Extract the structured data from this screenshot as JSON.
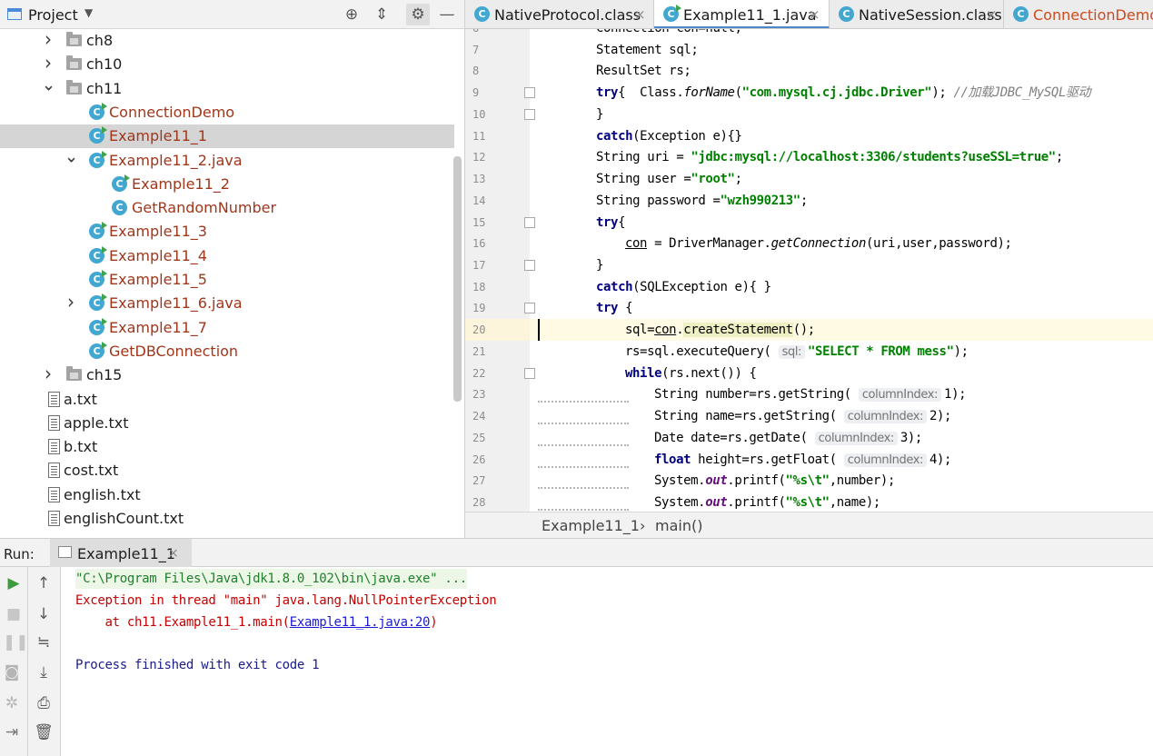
{
  "project_panel": {
    "title": "Project",
    "tree": [
      {
        "label": "ch8",
        "type": "folder",
        "indent": 0,
        "arrow": "collapsed"
      },
      {
        "label": "ch10",
        "type": "folder",
        "indent": 0,
        "arrow": "collapsed"
      },
      {
        "label": "ch11",
        "type": "folder",
        "indent": 0,
        "arrow": "expanded"
      },
      {
        "label": "ConnectionDemo",
        "type": "class",
        "indent": 1,
        "arrow": "none"
      },
      {
        "label": "Example11_1",
        "type": "class",
        "indent": 1,
        "arrow": "none",
        "selected": true
      },
      {
        "label": "Example11_2.java",
        "type": "class",
        "indent": 1,
        "arrow": "expanded"
      },
      {
        "label": "Example11_2",
        "type": "class",
        "indent": 2,
        "arrow": "none"
      },
      {
        "label": "GetRandomNumber",
        "type": "class-plain",
        "indent": 2,
        "arrow": "none"
      },
      {
        "label": "Example11_3",
        "type": "class",
        "indent": 1,
        "arrow": "none"
      },
      {
        "label": "Example11_4",
        "type": "class",
        "indent": 1,
        "arrow": "none"
      },
      {
        "label": "Example11_5",
        "type": "class",
        "indent": 1,
        "arrow": "none"
      },
      {
        "label": "Example11_6.java",
        "type": "class",
        "indent": 1,
        "arrow": "collapsed"
      },
      {
        "label": "Example11_7",
        "type": "class",
        "indent": 1,
        "arrow": "none"
      },
      {
        "label": "GetDBConnection",
        "type": "class",
        "indent": 1,
        "arrow": "none"
      },
      {
        "label": "ch15",
        "type": "folder",
        "indent": 0,
        "arrow": "collapsed"
      },
      {
        "label": "a.txt",
        "type": "file",
        "indent": 0,
        "arrow": "none"
      },
      {
        "label": "apple.txt",
        "type": "file",
        "indent": 0,
        "arrow": "none"
      },
      {
        "label": "b.txt",
        "type": "file",
        "indent": 0,
        "arrow": "none"
      },
      {
        "label": "cost.txt",
        "type": "file",
        "indent": 0,
        "arrow": "none"
      },
      {
        "label": "english.txt",
        "type": "file",
        "indent": 0,
        "arrow": "none"
      },
      {
        "label": "englishCount.txt",
        "type": "file",
        "indent": 0,
        "arrow": "none"
      }
    ]
  },
  "editor_tabs": [
    {
      "label": "NativeProtocol.class",
      "active": false
    },
    {
      "label": "Example11_1.java",
      "active": true
    },
    {
      "label": "NativeSession.class",
      "active": false
    },
    {
      "label": "ConnectionDemo.java",
      "active": false
    }
  ],
  "code_lines": [
    {
      "n": "6",
      "indent": 2,
      "html": "Connection con=null;"
    },
    {
      "n": "7",
      "indent": 2,
      "html": "Statement sql;"
    },
    {
      "n": "8",
      "indent": 2,
      "html": "ResultSet rs;"
    },
    {
      "n": "9",
      "indent": 2,
      "fold": true,
      "html": "<span class=\"kw\">try</span>{  Class.<span class=\"ital\">forName</span>(<span class=\"str\">\"com.mysql.cj.jdbc.Driver\"</span>); <span class=\"cmt\">//加载JDBC_MySQL驱动</span>"
    },
    {
      "n": "10",
      "indent": 2,
      "fold": true,
      "html": "}"
    },
    {
      "n": "11",
      "indent": 2,
      "html": "<span class=\"kw\">catch</span>(Exception e){}"
    },
    {
      "n": "12",
      "indent": 2,
      "html": "String uri = <span class=\"str\">\"jdbc:mysql://localhost:3306/students?useSSL=true\"</span>;"
    },
    {
      "n": "13",
      "indent": 2,
      "html": "String user =<span class=\"str\">\"root\"</span>;"
    },
    {
      "n": "14",
      "indent": 2,
      "html": "String password =<span class=\"str\">\"wzh990213\"</span>;"
    },
    {
      "n": "15",
      "indent": 2,
      "fold": true,
      "html": "<span class=\"kw\">try</span>{"
    },
    {
      "n": "16",
      "indent": 3,
      "html": "<span class=\"und\">con</span> = DriverManager.<span class=\"ital\">getConnection</span>(uri,user,password);"
    },
    {
      "n": "17",
      "indent": 2,
      "fold": true,
      "html": "}"
    },
    {
      "n": "18",
      "indent": 2,
      "html": "<span class=\"kw\">catch</span>(SQLException e){ }"
    },
    {
      "n": "19",
      "indent": 2,
      "fold": true,
      "html": "<span class=\"kw\">try</span> {"
    },
    {
      "n": "20",
      "indent": 3,
      "current": true,
      "html": "sql=<span class=\"und\">con</span>.<span class=\"hl\">createStatement</span>();"
    },
    {
      "n": "21",
      "indent": 3,
      "html": "rs=sql.executeQuery( <span class=\"hint\">sql:</span><span class=\"str\">\"SELECT * FROM mess\"</span>);"
    },
    {
      "n": "22",
      "indent": 3,
      "fold": true,
      "html": "<span class=\"kw\">while</span>(rs.next()) {"
    },
    {
      "n": "23",
      "indent": 4,
      "squiggle": true,
      "html": "String number=rs.getString( <span class=\"hint\">columnIndex:</span>1);"
    },
    {
      "n": "24",
      "indent": 4,
      "squiggle": true,
      "html": "String name=rs.getString( <span class=\"hint\">columnIndex:</span>2);"
    },
    {
      "n": "25",
      "indent": 4,
      "squiggle": true,
      "html": "Date date=rs.getDate( <span class=\"hint\">columnIndex:</span>3);"
    },
    {
      "n": "26",
      "indent": 4,
      "squiggle": true,
      "html": "<span class=\"kw\">float</span> height=rs.getFloat( <span class=\"hint\">columnIndex:</span>4);"
    },
    {
      "n": "27",
      "indent": 4,
      "squiggle": true,
      "html": "System.<span class=\"fld\">out</span>.printf(<span class=\"str\">\"%s\\t\"</span>,number);"
    },
    {
      "n": "28",
      "indent": 4,
      "squiggle": true,
      "html": "System.<span class=\"fld\">out</span>.printf(<span class=\"str\">\"%s\\t\"</span>,name);"
    }
  ],
  "breadcrumb": {
    "class": "Example11_1",
    "separator": "›",
    "method": "main()"
  },
  "run_panel": {
    "label": "Run:",
    "tab": "Example11_1",
    "console": [
      {
        "text": "\"C:\\Program Files\\Java\\jdk1.8.0_102\\bin\\java.exe\" ...",
        "style": "cmd"
      },
      {
        "text": "Exception in thread \"main\" java.lang.NullPointerException",
        "style": "err"
      },
      {
        "text": "    at ch11.Example11_1.main(",
        "style": "err",
        "link": "Example11_1.java:20",
        "suffix": ")"
      },
      {
        "text": "",
        "style": "norm"
      },
      {
        "text": "Process finished with exit code 1",
        "style": "norm"
      }
    ]
  }
}
